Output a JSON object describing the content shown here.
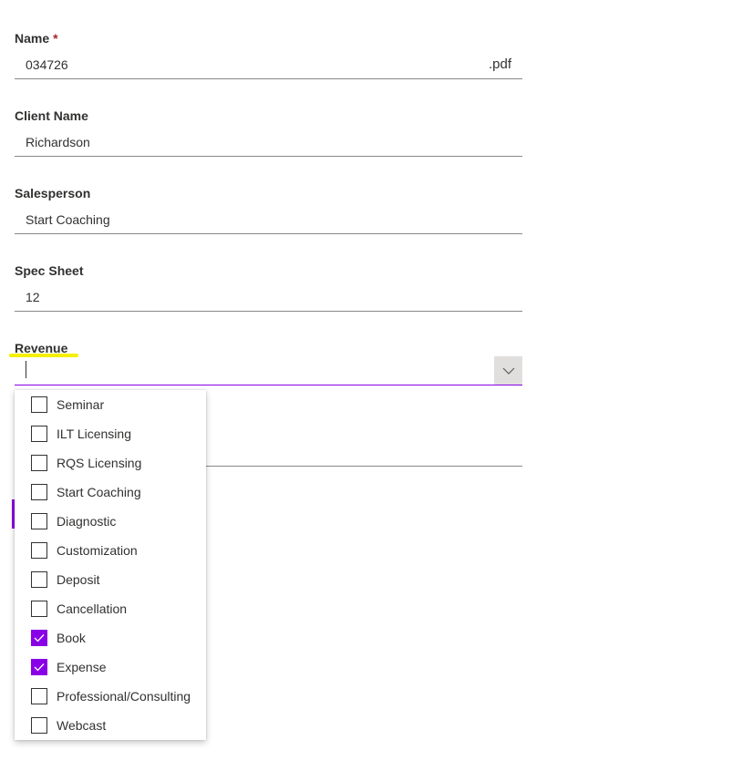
{
  "form": {
    "name": {
      "label": "Name",
      "required_mark": "*",
      "value": "034726",
      "suffix": ".pdf"
    },
    "client_name": {
      "label": "Client Name",
      "value": "Richardson"
    },
    "salesperson": {
      "label": "Salesperson",
      "value": "Start Coaching"
    },
    "spec_sheet": {
      "label": "Spec Sheet",
      "value": "12"
    },
    "revenue": {
      "label": "Revenue",
      "value": "",
      "highlight_color": "#f5f000"
    }
  },
  "revenue_dropdown": {
    "options": [
      {
        "label": "Seminar",
        "checked": false
      },
      {
        "label": "ILT Licensing",
        "checked": false
      },
      {
        "label": "RQS Licensing",
        "checked": false
      },
      {
        "label": "Start Coaching",
        "checked": false
      },
      {
        "label": "Diagnostic",
        "checked": false
      },
      {
        "label": "Customization",
        "checked": false
      },
      {
        "label": "Deposit",
        "checked": false
      },
      {
        "label": "Cancellation",
        "checked": false
      },
      {
        "label": "Book",
        "checked": true
      },
      {
        "label": "Expense",
        "checked": true
      },
      {
        "label": "Professional/Consulting",
        "checked": false
      },
      {
        "label": "Webcast",
        "checked": false
      }
    ]
  },
  "colors": {
    "accent": "#8a00e6",
    "underline": "#8a8886",
    "required": "#a4262c"
  },
  "icons": {
    "dropdown": "chevron-down-icon",
    "check": "checkmark-icon"
  }
}
